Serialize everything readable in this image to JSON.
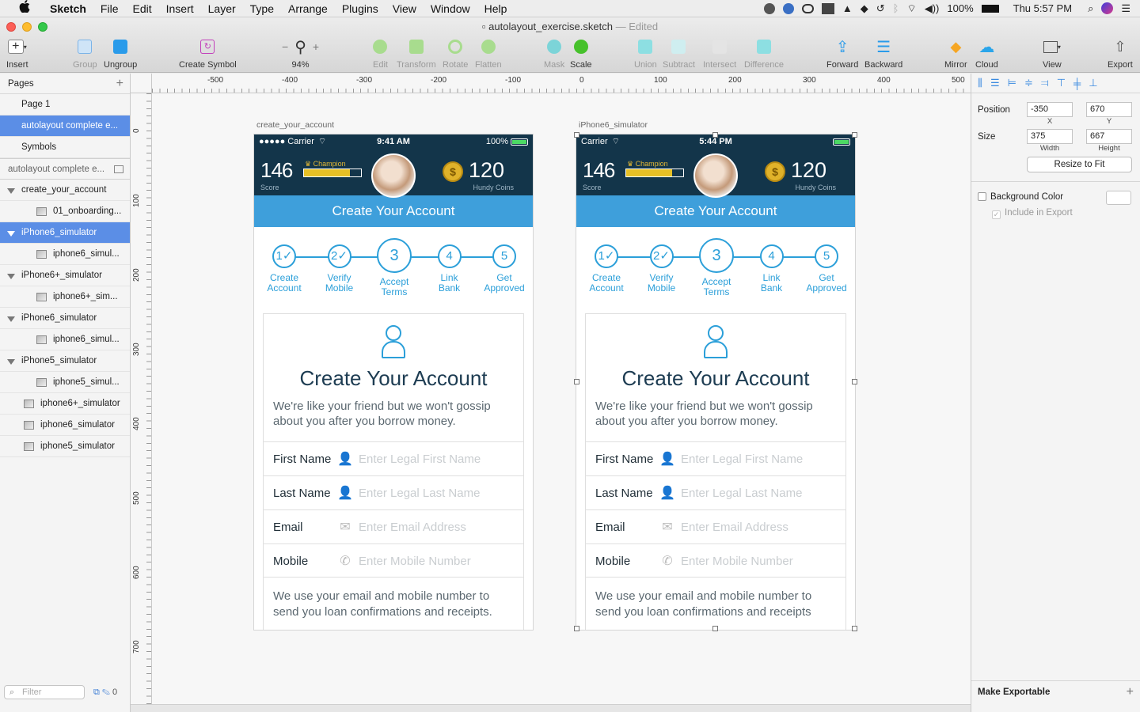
{
  "menubar": {
    "apple": "",
    "items": [
      "Sketch",
      "File",
      "Edit",
      "Insert",
      "Layer",
      "Type",
      "Arrange",
      "Plugins",
      "View",
      "Window",
      "Help"
    ],
    "battery": "100%",
    "clock": "Thu 5:57 PM"
  },
  "window": {
    "filename": "autolayout_exercise.sketch",
    "edited": "— Edited"
  },
  "toolbar": {
    "insert": "Insert",
    "group": "Group",
    "ungroup": "Ungroup",
    "create_symbol": "Create Symbol",
    "zoom_minus": "−",
    "zoom_plus": "+",
    "zoom": "94%",
    "edit": "Edit",
    "transform": "Transform",
    "rotate": "Rotate",
    "flatten": "Flatten",
    "mask": "Mask",
    "scale": "Scale",
    "union": "Union",
    "subtract": "Subtract",
    "intersect": "Intersect",
    "difference": "Difference",
    "forward": "Forward",
    "backward": "Backward",
    "mirror": "Mirror",
    "cloud": "Cloud",
    "view": "View",
    "export": "Export"
  },
  "sidebar": {
    "pages_title": "Pages",
    "pages": [
      "Page 1",
      "autolayout complete e...",
      "Symbols"
    ],
    "artboard_header": "autolayout complete e...",
    "layers": [
      {
        "kind": "group",
        "label": "create_your_account"
      },
      {
        "kind": "child",
        "label": "01_onboarding..."
      },
      {
        "kind": "group",
        "label": "iPhone6_simulator",
        "selected": true
      },
      {
        "kind": "child",
        "label": "iphone6_simul..."
      },
      {
        "kind": "group",
        "label": "iPhone6+_simulator"
      },
      {
        "kind": "child",
        "label": "iphone6+_sim..."
      },
      {
        "kind": "group",
        "label": "iPhone6_simulator"
      },
      {
        "kind": "child",
        "label": "iphone6_simul..."
      },
      {
        "kind": "group",
        "label": "iPhone5_simulator"
      },
      {
        "kind": "child",
        "label": "iphone5_simul..."
      },
      {
        "kind": "art",
        "label": "iphone6+_simulator"
      },
      {
        "kind": "art",
        "label": "iphone6_simulator"
      },
      {
        "kind": "art",
        "label": "iphone5_simulator"
      }
    ],
    "filter_placeholder": "Filter",
    "filter_count": "0"
  },
  "rulers": {
    "h": [
      "-500",
      "-400",
      "-300",
      "-200",
      "-100",
      "0",
      "100",
      "200",
      "300",
      "400",
      "500"
    ],
    "v": [
      "0",
      "100",
      "200",
      "300",
      "400",
      "500",
      "600",
      "700"
    ]
  },
  "artboards": [
    {
      "label": "create_your_account",
      "carrier": "●●●●● Carrier",
      "time": "9:41 AM",
      "battery": "100%",
      "score": "146",
      "score_label": "Score",
      "champion": "♛ Champion",
      "coins": "120",
      "coins_label": "Hundy Coins",
      "coin_symbol": "$",
      "banner": "Create Your Account",
      "steps": [
        {
          "num": "1✓",
          "label": "Create\nAccount"
        },
        {
          "num": "2✓",
          "label": "Verify\nMobile"
        },
        {
          "num": "3",
          "label": "Accept\nTerms"
        },
        {
          "num": "4",
          "label": "Link\nBank"
        },
        {
          "num": "5",
          "label": "Get\nApproved"
        }
      ],
      "card_title": "Create Your Account",
      "card_sub": "We're like your friend but we won't gossip about you after you borrow money.",
      "fields": [
        {
          "label": "First Name",
          "icon": "person",
          "placeholder": "Enter Legal First Name"
        },
        {
          "label": "Last Name",
          "icon": "person",
          "placeholder": "Enter Legal Last Name"
        },
        {
          "label": "Email",
          "icon": "mail",
          "placeholder": "Enter Email Address"
        },
        {
          "label": "Mobile",
          "icon": "phone",
          "placeholder": "Enter Mobile Number"
        }
      ],
      "footer": "We use your email and mobile number to send you loan confirmations and receipts."
    },
    {
      "label": "iPhone6_simulator",
      "carrier": "Carrier",
      "time": "5:44 PM",
      "battery": "",
      "score": "146",
      "score_label": "Score",
      "champion": "♛ Champion",
      "coins": "120",
      "coins_label": "Hundy Coins",
      "coin_symbol": "$",
      "banner": "Create Your Account",
      "steps": [
        {
          "num": "1✓",
          "label": "Create\nAccount"
        },
        {
          "num": "2✓",
          "label": "Verify\nMobile"
        },
        {
          "num": "3",
          "label": "Accept\nTerms"
        },
        {
          "num": "4",
          "label": "Link\nBank"
        },
        {
          "num": "5",
          "label": "Get\nApproved"
        }
      ],
      "card_title": "Create Your Account",
      "card_sub": "We're like your friend but we won't gossip about you after you borrow money.",
      "fields": [
        {
          "label": "First Name",
          "icon": "person",
          "placeholder": "Enter Legal First Name"
        },
        {
          "label": "Last Name",
          "icon": "person",
          "placeholder": "Enter Legal Last Name"
        },
        {
          "label": "Email",
          "icon": "mail",
          "placeholder": "Enter Email Address"
        },
        {
          "label": "Mobile",
          "icon": "phone",
          "placeholder": "Enter Mobile Number"
        }
      ],
      "footer": "We use your email and mobile number to send you loan confirmations and receipts"
    }
  ],
  "inspector": {
    "position_label": "Position",
    "x": "-350",
    "y": "670",
    "x_label": "X",
    "y_label": "Y",
    "size_label": "Size",
    "width": "375",
    "height": "667",
    "width_label": "Width",
    "height_label": "Height",
    "resize_btn": "Resize to Fit",
    "bg_color": "Background Color",
    "include_export": "Include in Export",
    "make_exportable": "Make Exportable"
  },
  "colors": {
    "accent": "#3e9fdb",
    "header_dark": "#13354a",
    "selection": "#5b8ee6",
    "gold": "#e6c026"
  }
}
